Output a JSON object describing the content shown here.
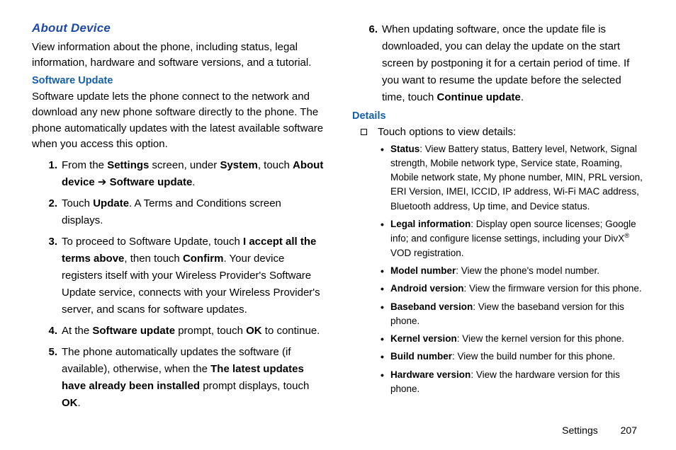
{
  "left": {
    "heading": "About Device",
    "intro": "View information about the phone, including status, legal information, hardware and software versions, and a tutorial.",
    "sub_heading": "Software Update",
    "para": "Software update lets the phone connect to the network and download any new phone software directly to the phone. The phone automatically updates with the latest available software when you access this option.",
    "steps": {
      "s1a": "From the ",
      "s1b": "Settings",
      "s1c": " screen, under ",
      "s1d": "System",
      "s1e": ", touch ",
      "s1f": "About device",
      "s1g": " ➔ ",
      "s1h": "Software update",
      "s1i": ".",
      "s2a": "Touch ",
      "s2b": "Update",
      "s2c": ". A Terms and Conditions screen displays.",
      "s3a": "To proceed to Software Update, touch ",
      "s3b": "I accept all the terms above",
      "s3c": ", then touch ",
      "s3d": "Confirm",
      "s3e": ". Your device registers itself with your Wireless Provider's Software Update service, connects with your Wireless Provider's server, and scans for software updates.",
      "s4a": "At the ",
      "s4b": "Software update",
      "s4c": " prompt, touch ",
      "s4d": "OK",
      "s4e": " to continue.",
      "s5a": "The phone automatically updates the software (if available), otherwise, when the ",
      "s5b": "The latest updates have already been installed",
      "s5c": " prompt displays, touch ",
      "s5d": "OK",
      "s5e": "."
    }
  },
  "right": {
    "s6a": "When updating software, once the update file is downloaded, you can delay the update on the start screen by postponing it for a certain period of time. If you want to resume the update before the selected time, touch ",
    "s6b": "Continue update",
    "s6c": ".",
    "details_heading": "Details",
    "touch_options": "Touch options to view details:",
    "items": {
      "i1a": "Status",
      "i1b": ": View Battery status, Battery level, Network, Signal strength, Mobile network type, Service state, Roaming, Mobile network state, My phone number, MIN, PRL version, ERI Version, IMEI, ICCID, IP address, Wi-Fi MAC address, Bluetooth address, Up time, and Device status.",
      "i2a": "Legal information",
      "i2b": ": Display open source licenses; Google info; and configure license settings, including your DivX",
      "i2c": " VOD registration.",
      "i3a": "Model number",
      "i3b": ": View the phone's model number.",
      "i4a": "Android version",
      "i4b": ": View the firmware version for this phone.",
      "i5a": "Baseband version",
      "i5b": ": View the baseband version for this phone.",
      "i6a": "Kernel version",
      "i6b": ": View the kernel version for this phone.",
      "i7a": "Build number",
      "i7b": ": View the build number for this phone.",
      "i8a": "Hardware version",
      "i8b": ": View the hardware version for this phone."
    }
  },
  "footer": {
    "section": "Settings",
    "page": "207"
  }
}
